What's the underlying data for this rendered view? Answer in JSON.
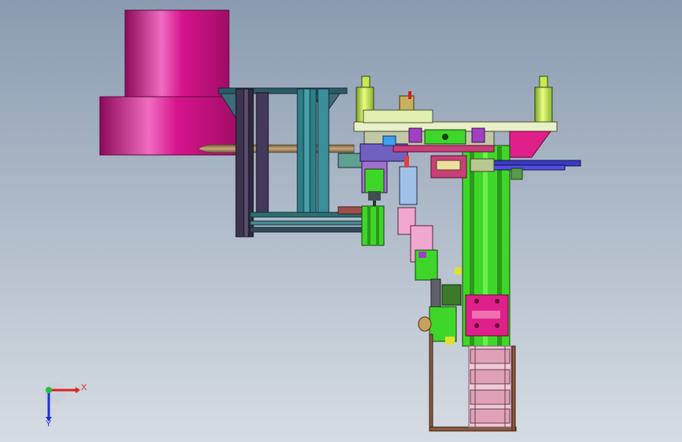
{
  "viewport": {
    "background_top": "#8a9bb1",
    "background_bottom": "#d6dce3"
  },
  "triad": {
    "x_label": "X",
    "y_label": "Y",
    "x_color": "#e02020",
    "y_color": "#2030d0",
    "origin_color": "#20c040"
  },
  "model": {
    "colors": {
      "hopper": "#d6148c",
      "frame_dark": "#3d3550",
      "frame_teal": "#2d7f87",
      "plate_top": "#e8f0c8",
      "column_green": "#3fd62a",
      "cylinder": "#c8e850",
      "bracket_magenta": "#e0208a",
      "pink_block": "#f0a8d0",
      "blue_rod": "#3a3ac0",
      "bronze": "#9a7a50"
    }
  }
}
